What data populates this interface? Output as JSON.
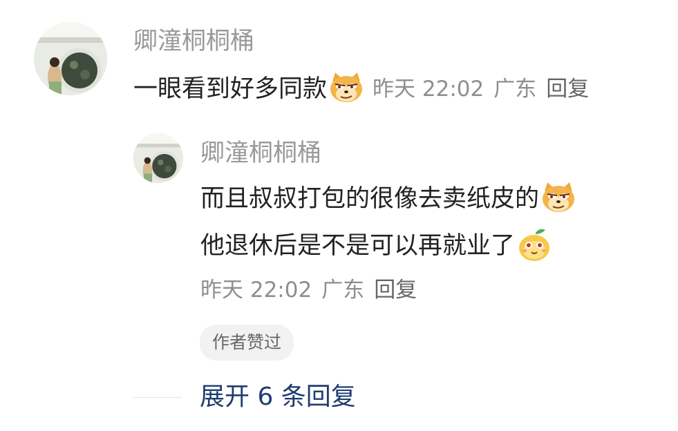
{
  "comment": {
    "username": "卿潼桐桐桶",
    "text": "一眼看到好多同款",
    "emoji": "doge-smirk-emoji",
    "time": "昨天 22:02",
    "location": "广东",
    "reply_label": "回复"
  },
  "reply": {
    "username": "卿潼桐桐桶",
    "line1": "而且叔叔打包的很像去卖纸皮的",
    "line1_emoji": "doge-smirk-emoji",
    "line2": "他退休后是不是可以再就业了",
    "line2_emoji": "cute-fruit-face-emoji",
    "time": "昨天 22:02",
    "location": "广东",
    "reply_label": "回复",
    "liked_tag": "作者赞过"
  },
  "expand": {
    "label": "展开 6 条回复"
  },
  "colors": {
    "username": "#9a9a9a",
    "text": "#222222",
    "meta": "#8e8e8e",
    "expand_link": "#1e3c70",
    "tag_bg": "#f2f2f2"
  }
}
